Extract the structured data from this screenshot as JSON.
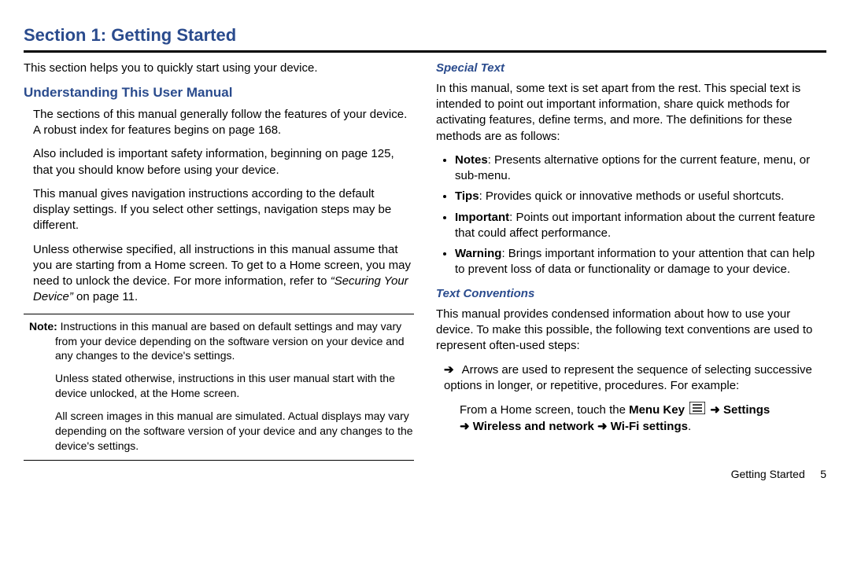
{
  "section_title": "Section 1: Getting Started",
  "left": {
    "intro": "This section helps you to quickly start using your device.",
    "heading1": "Understanding This User Manual",
    "p1": "The sections of this manual generally follow the features of your device. A robust index for features begins on page 168.",
    "p2": "Also included is important safety information, beginning on page 125, that you should know before using your device.",
    "p3": "This manual gives navigation instructions according to the default display settings. If you select other settings, navigation steps may be different.",
    "p4a": "Unless otherwise specified, all instructions in this manual assume that you are starting from a Home screen. To get to a Home screen, you may need to unlock the device. For more information, refer to ",
    "p4_ref": "“Securing Your Device”",
    "p4b": "  on page 11.",
    "note_label": "Note:",
    "note1": " Instructions in this manual are based on default settings and may vary from your device depending on the software version on your device and any changes to the device's settings.",
    "note2": "Unless stated otherwise, instructions in this user manual start with the device unlocked, at the Home screen.",
    "note3": "All screen images in this manual are simulated. Actual displays may vary depending on the software version of your device and any changes to the device's settings."
  },
  "right": {
    "heading_special": "Special Text",
    "p_special": "In this manual, some text is set apart from the rest. This special text is intended to point out important information, share quick methods for activating features, define terms, and more. The definitions for these methods are as follows:",
    "bullets": [
      {
        "label": "Notes",
        "text": ": Presents alternative options for the current feature, menu, or sub-menu."
      },
      {
        "label": "Tips",
        "text": ": Provides quick or innovative methods or useful shortcuts."
      },
      {
        "label": "Important",
        "text": ": Points out important information about the current feature that could affect performance."
      },
      {
        "label": "Warning",
        "text": ": Brings important information to your attention that can help to prevent loss of data or functionality or damage to your device."
      }
    ],
    "heading_conv": "Text Conventions",
    "p_conv": "This manual provides condensed information about how to use your device. To make this possible, the following text conventions are used to represent often-used steps:",
    "arrow_item": "Arrows are used to represent the sequence of selecting successive options in longer, or repetitive, procedures. For example:",
    "example_prefix": "From a Home screen, touch the ",
    "menu_key_label": "Menu Key",
    "arrow_glyph": "➜",
    "settings_label": "Settings",
    "wireless_label": "Wireless and network",
    "wifi_label": "Wi-Fi settings"
  },
  "footer": {
    "title": "Getting Started",
    "page": "5"
  }
}
